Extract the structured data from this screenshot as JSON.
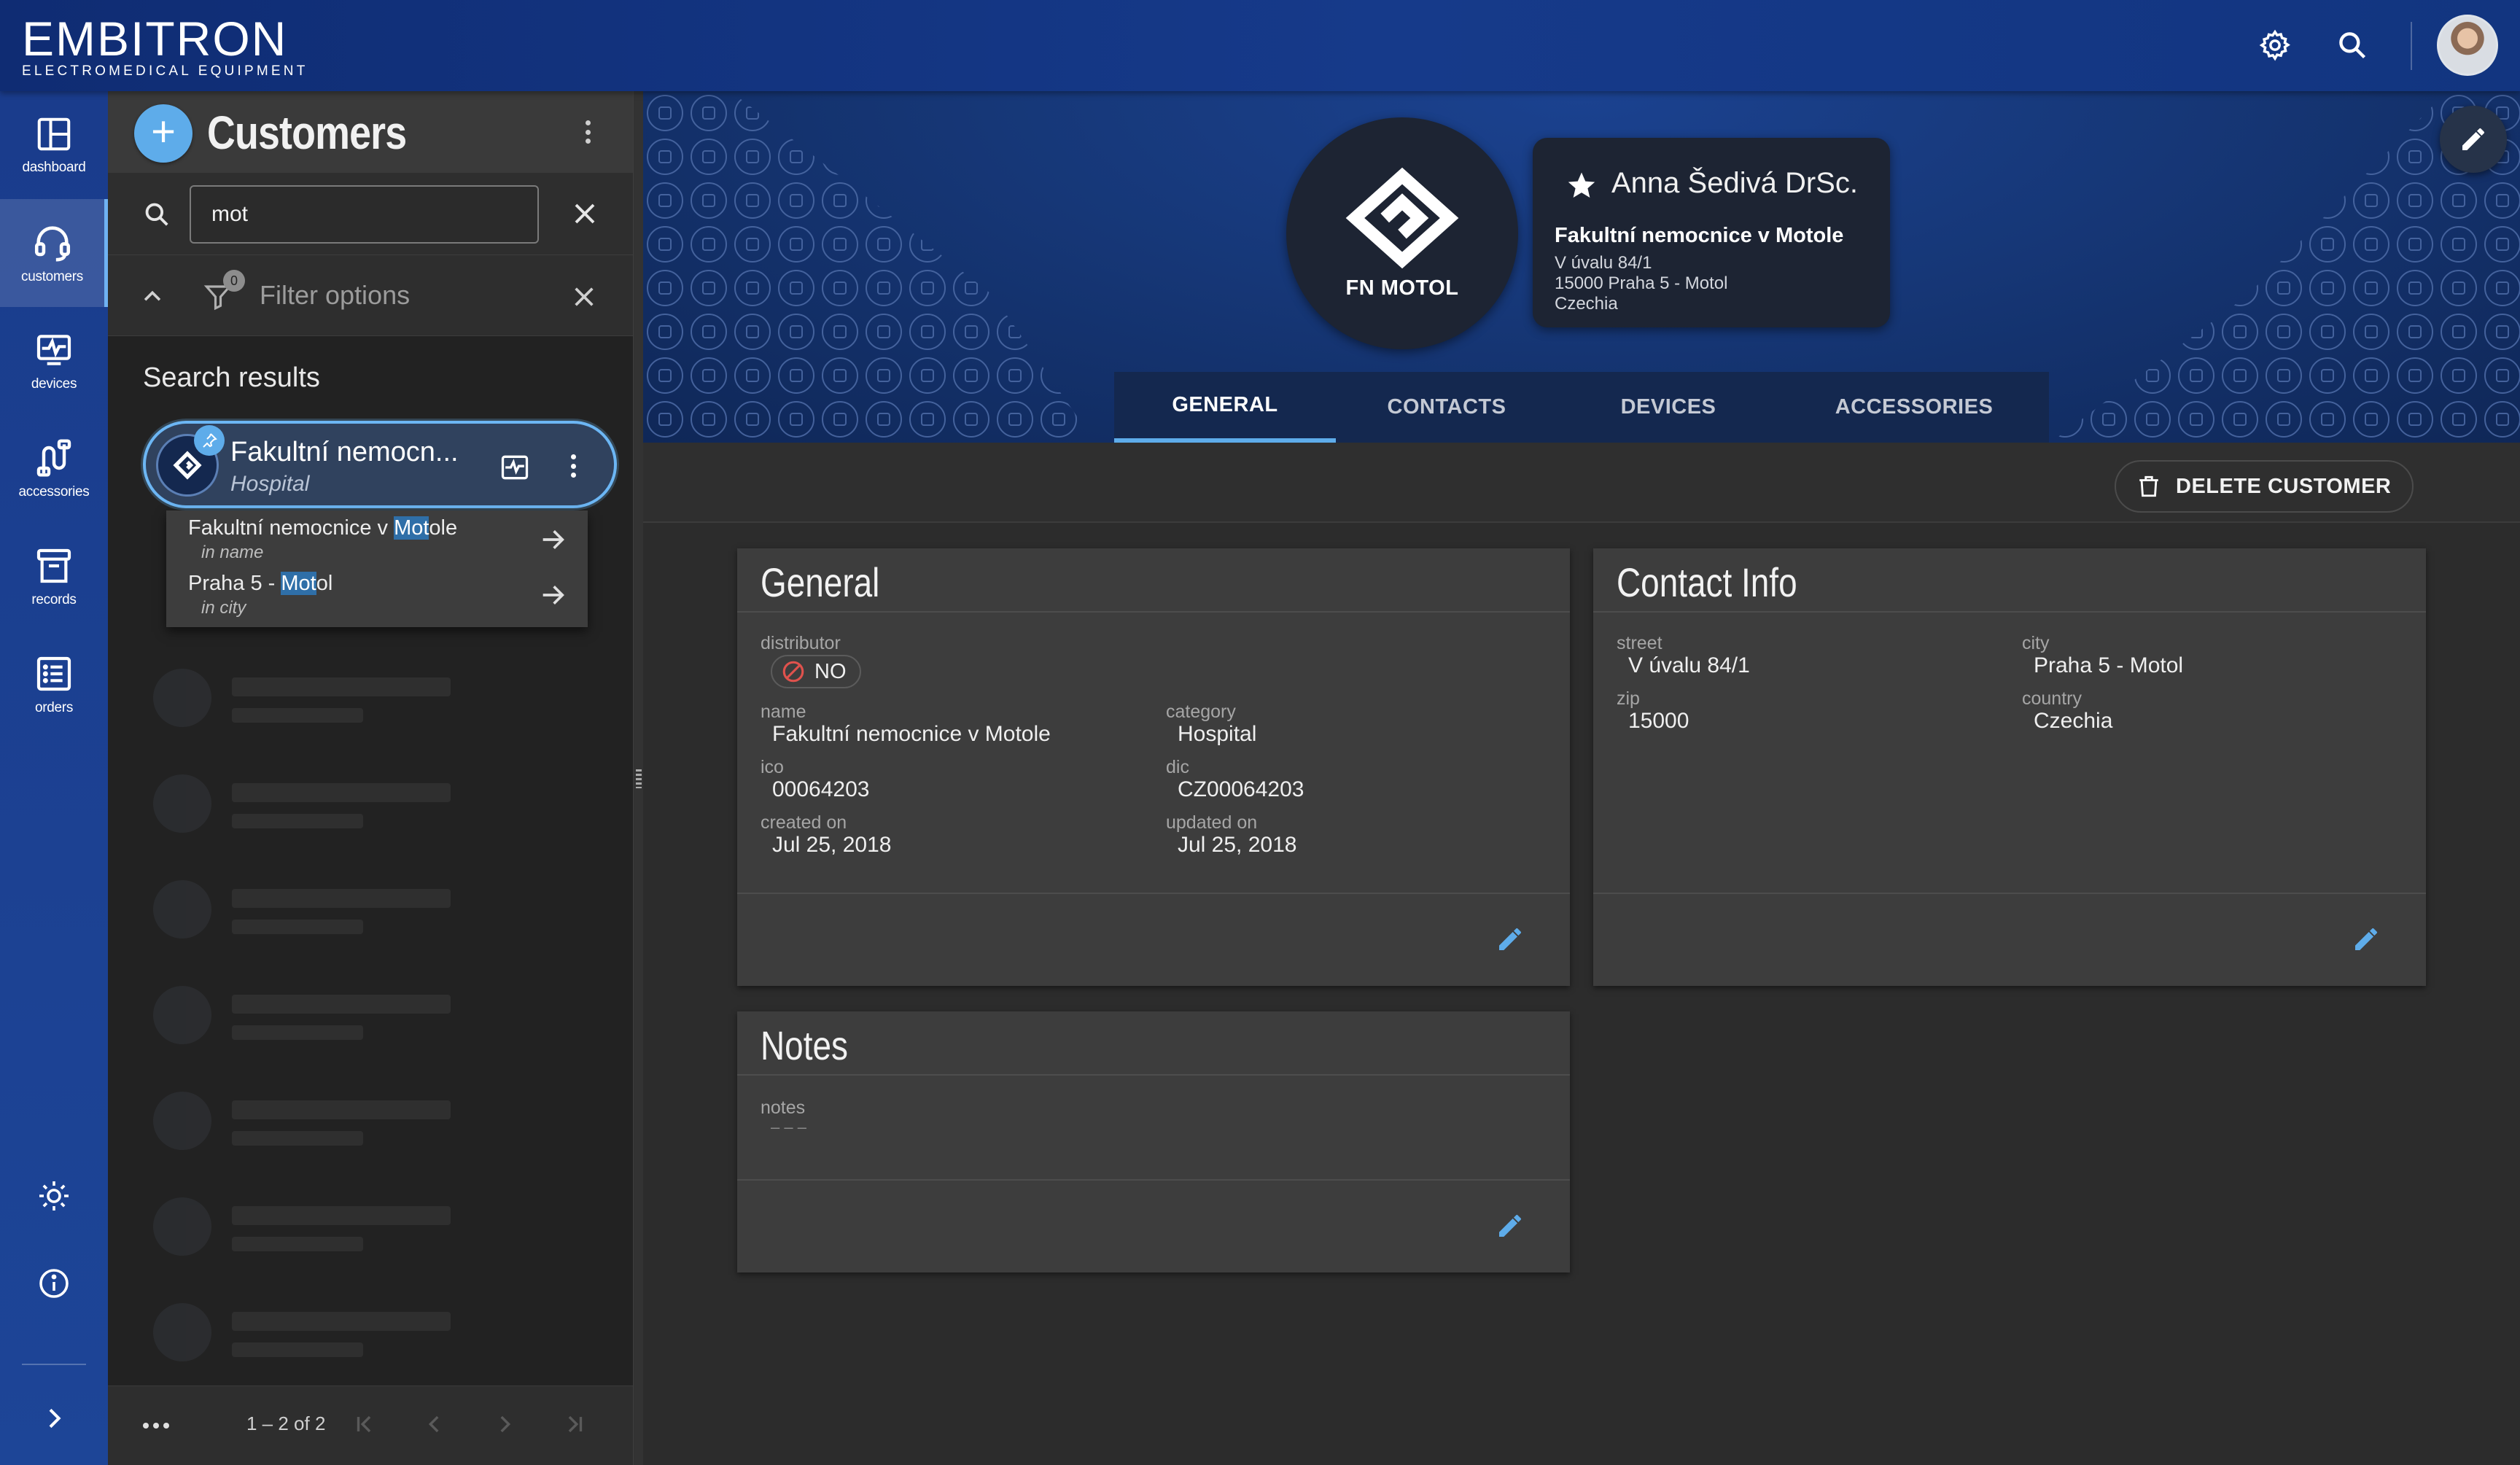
{
  "header": {
    "brand_name": "EMBITRON",
    "brand_subtitle": "ELECTROMEDICAL EQUIPMENT",
    "icons": [
      "gear-icon",
      "search-icon"
    ]
  },
  "rail": {
    "items": [
      {
        "label": "dashboard",
        "icon": "dashboard-icon"
      },
      {
        "label": "customers",
        "icon": "headset-icon",
        "active": true
      },
      {
        "label": "devices",
        "icon": "monitor-icon"
      },
      {
        "label": "accessories",
        "icon": "accessories-icon"
      },
      {
        "label": "records",
        "icon": "archive-icon"
      },
      {
        "label": "orders",
        "icon": "list-icon"
      }
    ],
    "bottom_icons": [
      "brightness-icon",
      "info-icon",
      "expand-icon"
    ]
  },
  "panel": {
    "title": "Customers",
    "search_value": "mot",
    "filter_count": "0",
    "filter_label": "Filter options",
    "results_title": "Search results",
    "result": {
      "name": "Fakultní nemocn...",
      "category": "Hospital"
    },
    "suggestions": [
      {
        "pre": "Fakultní nemocnice v ",
        "match": "Mot",
        "post": "ole",
        "sub": "in name"
      },
      {
        "pre": "Praha 5 - ",
        "match": "Mot",
        "post": "ol",
        "sub": "in city"
      }
    ],
    "paginator": {
      "range": "1 – 2 of 2"
    }
  },
  "hero": {
    "logo_text": "FN MOTOL",
    "person": "Anna Šedivá DrSc.",
    "organization": "Fakultní nemocnice v Motole",
    "address_lines": [
      "V úvalu 84/1",
      "15000 Praha 5 - Motol",
      "Czechia"
    ],
    "tabs": [
      {
        "label": "GENERAL",
        "active": true
      },
      {
        "label": "CONTACTS"
      },
      {
        "label": "DEVICES"
      },
      {
        "label": "ACCESSORIES"
      }
    ]
  },
  "actions": {
    "delete_label": "DELETE CUSTOMER"
  },
  "general": {
    "title": "General",
    "distributor_label": "distributor",
    "distributor_value": "NO",
    "name_label": "name",
    "name_value": "Fakultní nemocnice v Motole",
    "category_label": "category",
    "category_value": "Hospital",
    "ico_label": "ico",
    "ico_value": "00064203",
    "dic_label": "dic",
    "dic_value": "CZ00064203",
    "created_label": "created on",
    "created_value": "Jul 25, 2018",
    "updated_label": "updated on",
    "updated_value": "Jul 25, 2018"
  },
  "contact": {
    "title": "Contact Info",
    "street_label": "street",
    "street_value": "V úvalu 84/1",
    "city_label": "city",
    "city_value": "Praha 5 - Motol",
    "zip_label": "zip",
    "zip_value": "15000",
    "country_label": "country",
    "country_value": "Czechia"
  },
  "notes": {
    "title": "Notes",
    "notes_label": "notes",
    "notes_value": "– – –"
  },
  "colors": {
    "accent": "#5eacea",
    "header": "#133581",
    "rail": "#1c4294",
    "background": "#2c2c2c",
    "card": "#3d3d3d"
  }
}
